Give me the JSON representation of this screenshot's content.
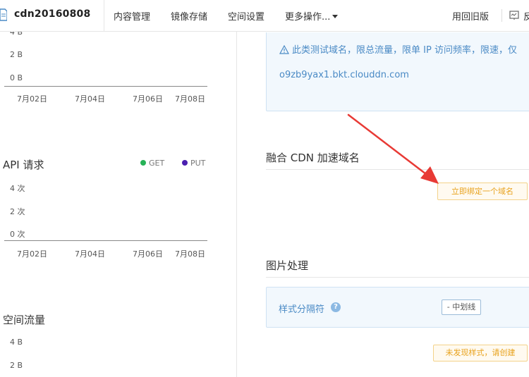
{
  "app": {
    "bucket_name": "cdn20160808",
    "nav": [
      "内容管理",
      "镜像存储",
      "空间设置",
      "更多操作..."
    ],
    "legacy_label": "用回旧版",
    "feedback_label": "反"
  },
  "colors": {
    "accent_blue": "#4a8ac5",
    "warning_orange": "#e8a21d",
    "get_series": "#27b257",
    "put_series": "#4b1fb0",
    "arrow_red": "#e83a35"
  },
  "charts": [
    {
      "type": "line",
      "title": "",
      "y_ticks": [
        "4 B",
        "2 B",
        "0 B"
      ],
      "x_ticks": [
        "7月02日",
        "7月04日",
        "7月06日",
        "7月08日"
      ]
    },
    {
      "type": "line",
      "title": "API 请求",
      "legend": [
        "GET",
        "PUT"
      ],
      "y_ticks": [
        "4 次",
        "2 次",
        "0 次"
      ],
      "x_ticks": [
        "7月02日",
        "7月04日",
        "7月06日",
        "7月08日"
      ]
    },
    {
      "type": "line",
      "title": "空间流量",
      "y_ticks": [
        "4 B",
        "2 B"
      ]
    }
  ],
  "test_domain": {
    "warning": "此类测试域名，限总流量，限单 IP 访问频率，限速，仅",
    "domain": "o9zb9yax1.bkt.clouddn.com"
  },
  "cdn": {
    "title": "融合 CDN 加速域名",
    "bind_button": "立即绑定一个域名"
  },
  "image_processing": {
    "title": "图片处理",
    "separator_label": "样式分隔符",
    "help_symbol": "?",
    "separator_value": "- 中划线",
    "create_button": "未发现样式，请创建"
  }
}
